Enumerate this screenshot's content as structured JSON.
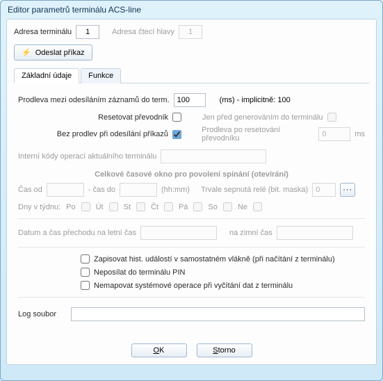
{
  "window": {
    "title": "Editor parametrů terminálu ACS-line"
  },
  "header": {
    "terminal_addr_label": "Adresa terminálu",
    "terminal_addr_value": "1",
    "reader_addr_label": "Adresa čtecí hlavy",
    "reader_addr_value": "1",
    "send_button_label": "Odeslat příkaz"
  },
  "tabs": {
    "tab1_label": "Základní údaje",
    "tab2_label": "Funkce"
  },
  "basic": {
    "delay_label": "Prodleva mezi odesíláním záznamů do term.",
    "delay_value": "100",
    "delay_unit_hint": "(ms) - implicitně: 100",
    "reset_converter_label": "Resetovat převodník",
    "reset_converter_checked": false,
    "before_gen_label": "Jen před generováním do terminálu",
    "before_gen_checked": false,
    "no_delay_label": "Bez prodlev při odesílání příkazů",
    "no_delay_checked": true,
    "post_reset_delay_label": "Prodleva po resetování převodníku",
    "post_reset_delay_value": "0",
    "post_reset_unit": "ms",
    "internal_codes_label": "Interní kódy operací aktuálního terminálu",
    "internal_codes_value": "",
    "time_window_title": "Celkové časové okno pro povolení spínání (otevírání)",
    "time_from_label": "Čas od",
    "time_from_value": "",
    "time_to_label": "- čas do",
    "time_to_value": "",
    "time_hint": "(hh:mm)",
    "relay_label": "Trvale sepnutá relé (bit. maska)",
    "relay_value": "0",
    "more_button_label": "···",
    "days_label": "Dny v týdnu:",
    "days": [
      {
        "short": "Po",
        "checked": false
      },
      {
        "short": "Út",
        "checked": false
      },
      {
        "short": "St",
        "checked": false
      },
      {
        "short": "Čt",
        "checked": false
      },
      {
        "short": "Pá",
        "checked": false
      },
      {
        "short": "So",
        "checked": false
      },
      {
        "short": "Ne",
        "checked": false
      }
    ],
    "dst_summer_label": "Datum a čas přechodu na letní čas",
    "dst_summer_value": "",
    "dst_winter_label": "na zimní čas",
    "dst_winter_value": "",
    "chk_hist_label": "Zapisovat hist. událostí v samostatném vlákně (při načítání z terminálu)",
    "chk_hist_checked": false,
    "chk_pin_label": "Neposílat do terminálu PIN",
    "chk_pin_checked": false,
    "chk_map_label": "Nemapovat systémové operace při vyčítání dat z terminálu",
    "chk_map_checked": false,
    "log_label": "Log soubor",
    "log_value": ""
  },
  "footer": {
    "ok_label": "OK",
    "ok_accel": "O",
    "cancel_label": "Storno",
    "cancel_accel": "S"
  },
  "icons": {
    "lightning": "⚡"
  }
}
